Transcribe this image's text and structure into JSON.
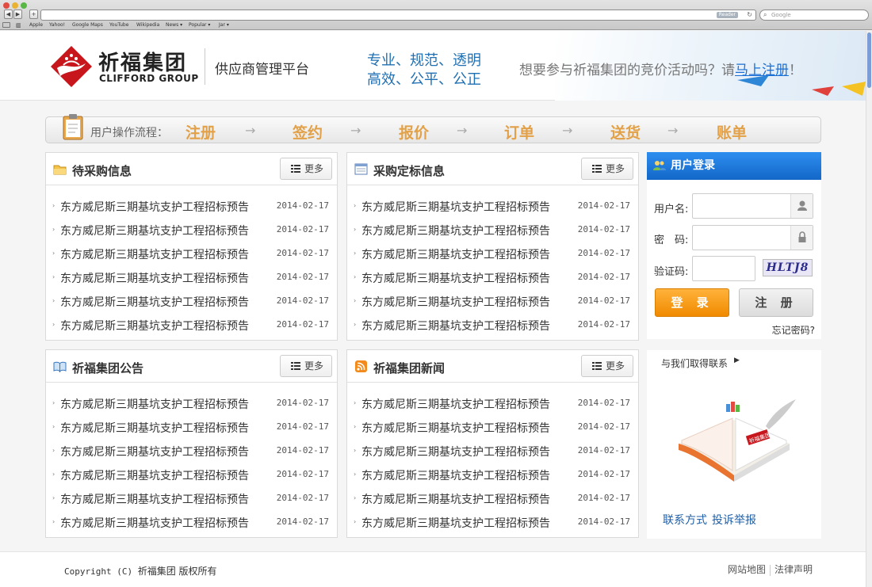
{
  "browser": {
    "reader_label": "Reader",
    "search_placeholder": "Google",
    "bookmarks": [
      "Apple",
      "Yahoo!",
      "Google Maps",
      "YouTube",
      "Wikipedia",
      "News ▾",
      "Popular ▾",
      "Jar ▾"
    ]
  },
  "header": {
    "logo_cn": "祈福集团",
    "logo_en": "CLIFFORD GROUP",
    "platform": "供应商管理平台",
    "slogan_line1": "专业、规范、透明",
    "slogan_line2": "高效、公平、公正",
    "invite_text": "想要参与祈福集团的竞价活动吗？请",
    "invite_link": "马上注册",
    "invite_end": "！"
  },
  "process": {
    "label": "用户操作流程：",
    "steps": [
      "注册",
      "签约",
      "报价",
      "订单",
      "送货",
      "账单"
    ],
    "arrow": "→"
  },
  "more_label": "更多",
  "panels": {
    "pending": {
      "title": "待采购信息",
      "rows": [
        {
          "title": "东方威尼斯三期基坑支护工程招标预告",
          "date": "2014-02-17"
        },
        {
          "title": "东方威尼斯三期基坑支护工程招标预告",
          "date": "2014-02-17"
        },
        {
          "title": "东方威尼斯三期基坑支护工程招标预告",
          "date": "2014-02-17"
        },
        {
          "title": "东方威尼斯三期基坑支护工程招标预告",
          "date": "2014-02-17"
        },
        {
          "title": "东方威尼斯三期基坑支护工程招标预告",
          "date": "2014-02-17"
        },
        {
          "title": "东方威尼斯三期基坑支护工程招标预告",
          "date": "2014-02-17"
        }
      ]
    },
    "awarded": {
      "title": "采购定标信息",
      "rows": [
        {
          "title": "东方威尼斯三期基坑支护工程招标预告",
          "date": "2014-02-17"
        },
        {
          "title": "东方威尼斯三期基坑支护工程招标预告",
          "date": "2014-02-17"
        },
        {
          "title": "东方威尼斯三期基坑支护工程招标预告",
          "date": "2014-02-17"
        },
        {
          "title": "东方威尼斯三期基坑支护工程招标预告",
          "date": "2014-02-17"
        },
        {
          "title": "东方威尼斯三期基坑支护工程招标预告",
          "date": "2014-02-17"
        },
        {
          "title": "东方威尼斯三期基坑支护工程招标预告",
          "date": "2014-02-17"
        }
      ]
    },
    "notice": {
      "title": "祈福集团公告",
      "rows": [
        {
          "title": "东方威尼斯三期基坑支护工程招标预告",
          "date": "2014-02-17"
        },
        {
          "title": "东方威尼斯三期基坑支护工程招标预告",
          "date": "2014-02-17"
        },
        {
          "title": "东方威尼斯三期基坑支护工程招标预告",
          "date": "2014-02-17"
        },
        {
          "title": "东方威尼斯三期基坑支护工程招标预告",
          "date": "2014-02-17"
        },
        {
          "title": "东方威尼斯三期基坑支护工程招标预告",
          "date": "2014-02-17"
        },
        {
          "title": "东方威尼斯三期基坑支护工程招标预告",
          "date": "2014-02-17"
        }
      ]
    },
    "news": {
      "title": "祈福集团新闻",
      "rows": [
        {
          "title": "东方威尼斯三期基坑支护工程招标预告",
          "date": "2014-02-17"
        },
        {
          "title": "东方威尼斯三期基坑支护工程招标预告",
          "date": "2014-02-17"
        },
        {
          "title": "东方威尼斯三期基坑支护工程招标预告",
          "date": "2014-02-17"
        },
        {
          "title": "东方威尼斯三期基坑支护工程招标预告",
          "date": "2014-02-17"
        },
        {
          "title": "东方威尼斯三期基坑支护工程招标预告",
          "date": "2014-02-17"
        },
        {
          "title": "东方威尼斯三期基坑支护工程招标预告",
          "date": "2014-02-17"
        }
      ]
    }
  },
  "login": {
    "title": "用户登录",
    "username_label": "用户名:",
    "password_label": "密　码:",
    "captcha_label": "验证码:",
    "captcha_text": "HLTJ8",
    "login_button": "登 录",
    "register_button": "注 册",
    "forgot": "忘记密码?"
  },
  "contact": {
    "title": "与我们取得联系",
    "arrow": "▶",
    "book_text": "祈福集团",
    "link_contact": "联系方式",
    "link_report": "投诉举报"
  },
  "footer": {
    "copyright_en": "Copyright (C) ",
    "copyright_cn": "祈福集团 版权所有",
    "sitemap": "网站地图",
    "legal": "法律声明"
  },
  "colors": {
    "accent_blue": "#1f6fb3",
    "step_orange": "#e2a148",
    "login_orange": "#f08a00",
    "login_head_blue": "#1367c7",
    "brand_red": "#c8161d"
  }
}
